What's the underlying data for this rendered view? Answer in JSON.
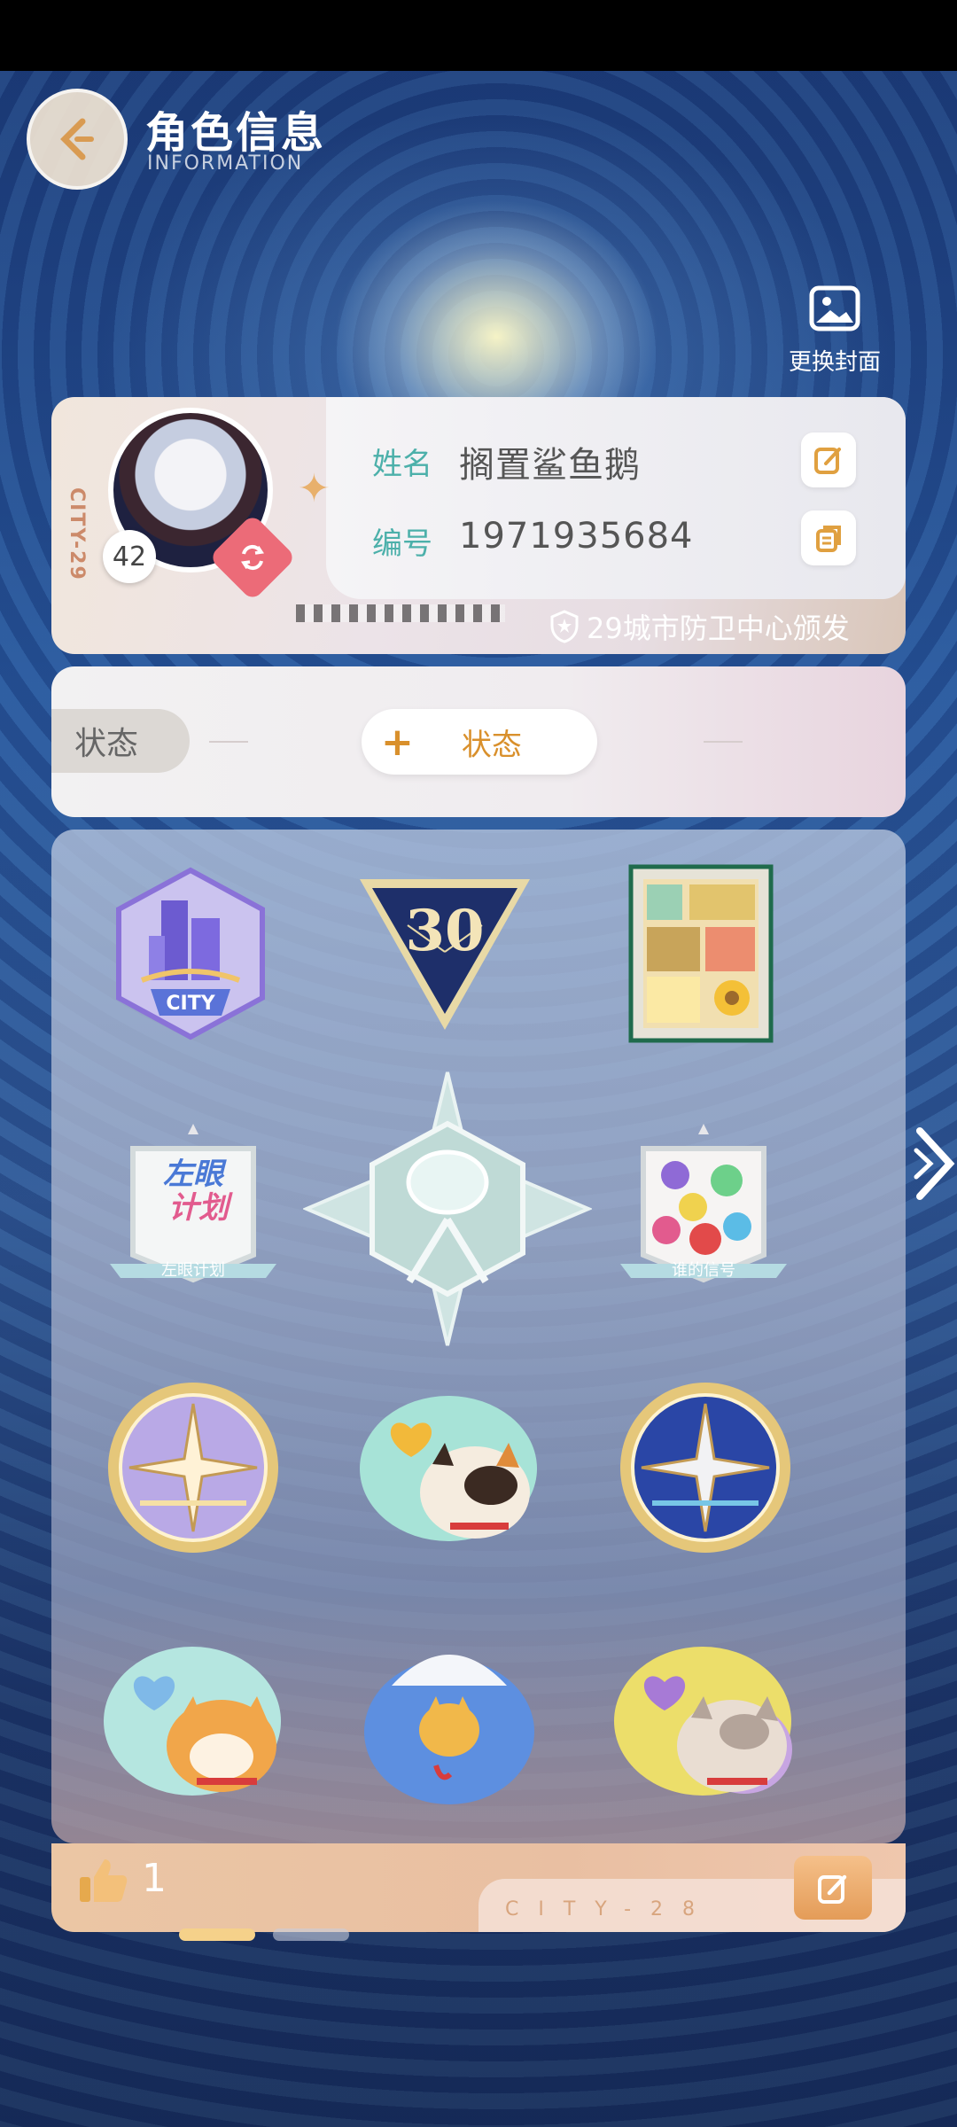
{
  "header": {
    "title_cn": "角色信息",
    "title_en": "INFORMATION"
  },
  "cover": {
    "label": "更换封面"
  },
  "profile": {
    "name_label": "姓名",
    "name": "搁置鲨鱼鹅",
    "id_label": "编号",
    "id": "1971935684",
    "level": "42",
    "city_tag": "CITY-29",
    "issuer": "29城市防卫中心颁发"
  },
  "status": {
    "tab_label": "状态",
    "add_label": "状态"
  },
  "badges": [
    {
      "name": "city-badge",
      "text": "CITY"
    },
    {
      "name": "thirty-triangle-badge",
      "text": "30"
    },
    {
      "name": "painting-frame-badge",
      "text": ""
    },
    {
      "name": "left-eye-plan-badge",
      "text": "左眼计划"
    },
    {
      "name": "compass-star-badge",
      "text": ""
    },
    {
      "name": "whose-signal-badge",
      "text": "谁的信号"
    },
    {
      "name": "purple-compass-badge",
      "text": ""
    },
    {
      "name": "calico-cat-badge",
      "text": ""
    },
    {
      "name": "blue-compass-badge",
      "text": ""
    },
    {
      "name": "orange-cat-badge",
      "text": ""
    },
    {
      "name": "umbrella-cat-badge",
      "text": ""
    },
    {
      "name": "grey-cat-badge",
      "text": ""
    }
  ],
  "footer": {
    "like_count": "1",
    "city_text": "CITY-28"
  },
  "colors": {
    "teal_label": "#4cb0aa",
    "accent_orange": "#d9902c",
    "swap_pink": "#ec6b78"
  }
}
